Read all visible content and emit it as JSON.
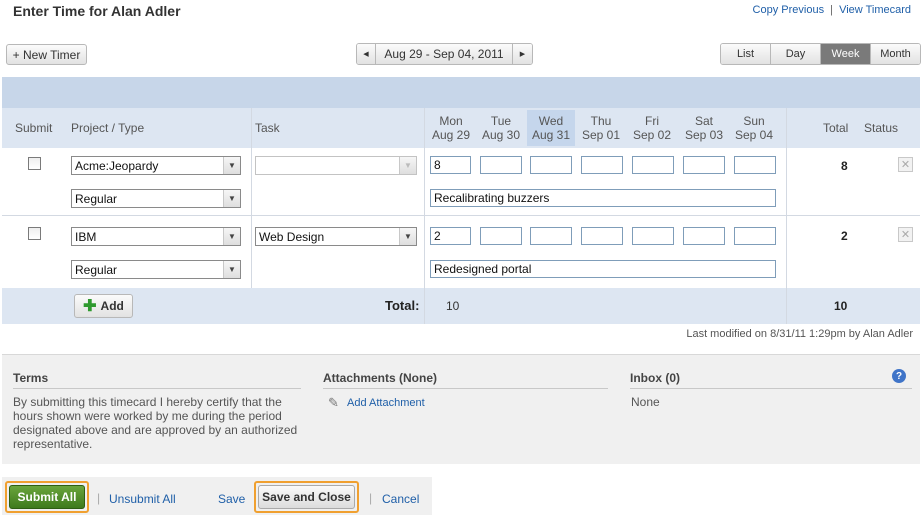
{
  "header": {
    "title": "Enter Time for Alan Adler",
    "copy_previous": "Copy Previous",
    "link_sep": "|",
    "view_timecard": "View Timecard"
  },
  "toolbar": {
    "new_timer": "+ New Timer",
    "date_range": "Aug 29 - Sep 04, 2011",
    "prev_arrow": "◀",
    "next_arrow": "▶",
    "views": [
      {
        "label": "List",
        "active": false
      },
      {
        "label": "Day",
        "active": false
      },
      {
        "label": "Week",
        "active": true
      },
      {
        "label": "Month",
        "active": false
      }
    ]
  },
  "table": {
    "headers": {
      "submit": "Submit",
      "project": "Project / Type",
      "task": "Task",
      "total": "Total",
      "status": "Status"
    },
    "days": [
      {
        "name": "Mon",
        "date": "Aug 29",
        "today": false
      },
      {
        "name": "Tue",
        "date": "Aug 30",
        "today": false
      },
      {
        "name": "Wed",
        "date": "Aug 31",
        "today": true
      },
      {
        "name": "Thu",
        "date": "Sep 01",
        "today": false
      },
      {
        "name": "Fri",
        "date": "Sep 02",
        "today": false
      },
      {
        "name": "Sat",
        "date": "Sep 03",
        "today": false
      },
      {
        "name": "Sun",
        "date": "Sep 04",
        "today": false
      }
    ],
    "rows": [
      {
        "project": "Acme:Jeopardy",
        "type": "Regular",
        "task": "",
        "hours": [
          "8",
          "",
          "",
          "",
          "",
          "",
          ""
        ],
        "note": "Recalibrating buzzers",
        "total": "8"
      },
      {
        "project": "IBM",
        "type": "Regular",
        "task": "Web Design",
        "hours": [
          "2",
          "",
          "",
          "",
          "",
          "",
          ""
        ],
        "note": "Redesigned portal",
        "total": "2"
      }
    ],
    "add_button": "Add",
    "total_label": "Total:",
    "mon_total": "10",
    "grand_total": "10"
  },
  "last_modified": "Last modified on 8/31/11 1:29pm by Alan Adler",
  "footer": {
    "terms_title": "Terms",
    "terms_text": "By submitting this timecard I hereby certify that the hours shown were worked by me during the period designated above and are approved by an authorized representative.",
    "attachments_title": "Attachments (None)",
    "add_attachment": "Add Attachment",
    "inbox_title": "Inbox (0)",
    "inbox_value": "None"
  },
  "actions": {
    "submit_all": "Submit All",
    "unsubmit_all": "Unsubmit All",
    "save": "Save",
    "save_and_close": "Save and Close",
    "cancel": "Cancel",
    "separator": "|"
  },
  "colors": {
    "accent_link": "#1f5fa8",
    "header_band": "#c7d6e9",
    "highlight_outline": "#f0a030",
    "submit_green": "#4e8c28"
  }
}
